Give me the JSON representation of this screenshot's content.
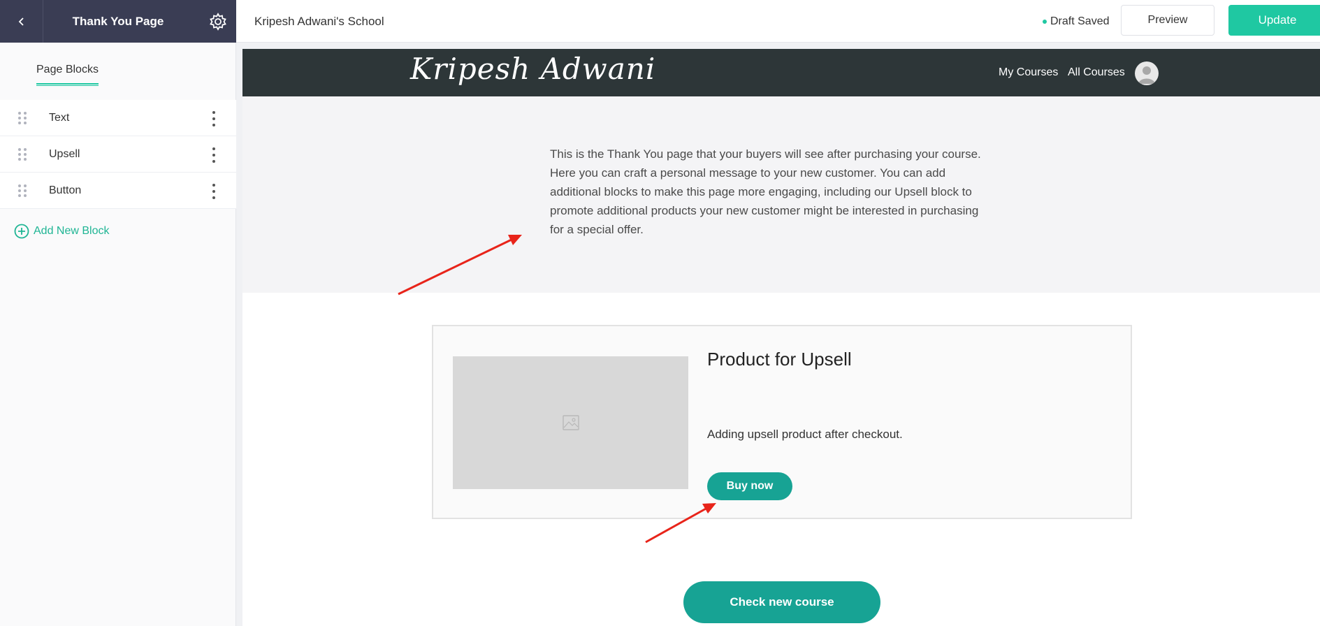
{
  "sidebar": {
    "header_title": "Thank You Page",
    "tab_label": "Page Blocks",
    "blocks": [
      {
        "label": "Text"
      },
      {
        "label": "Upsell"
      },
      {
        "label": "Button"
      }
    ],
    "add_block_label": "Add New Block"
  },
  "topbar": {
    "school_name": "Kripesh Adwani's School",
    "draft_status": "Draft Saved",
    "preview_label": "Preview",
    "update_label": "Update"
  },
  "site": {
    "logo_text": "Kripesh Adwani",
    "nav": {
      "my_courses": "My Courses",
      "all_courses": "All Courses"
    }
  },
  "thank_you": {
    "lines": [
      "This is the Thank You page that your buyers will see after purchasing your course.",
      "Here you can craft a personal message to your new customer. You can add",
      "additional blocks to make this page more engaging, including our Upsell block to",
      "promote additional products your new customer might be interested in purchasing",
      "for a special offer."
    ]
  },
  "upsell": {
    "title": "Product for Upsell",
    "description": "Adding upsell product after checkout.",
    "buy_label": "Buy now"
  },
  "cta": {
    "label": "Check new course"
  },
  "colors": {
    "accent": "#1fc8a2",
    "button": "#17a394",
    "nav_bg": "#2d3638",
    "sidebar_head": "#3a3d54",
    "annotation": "#e8241a"
  }
}
